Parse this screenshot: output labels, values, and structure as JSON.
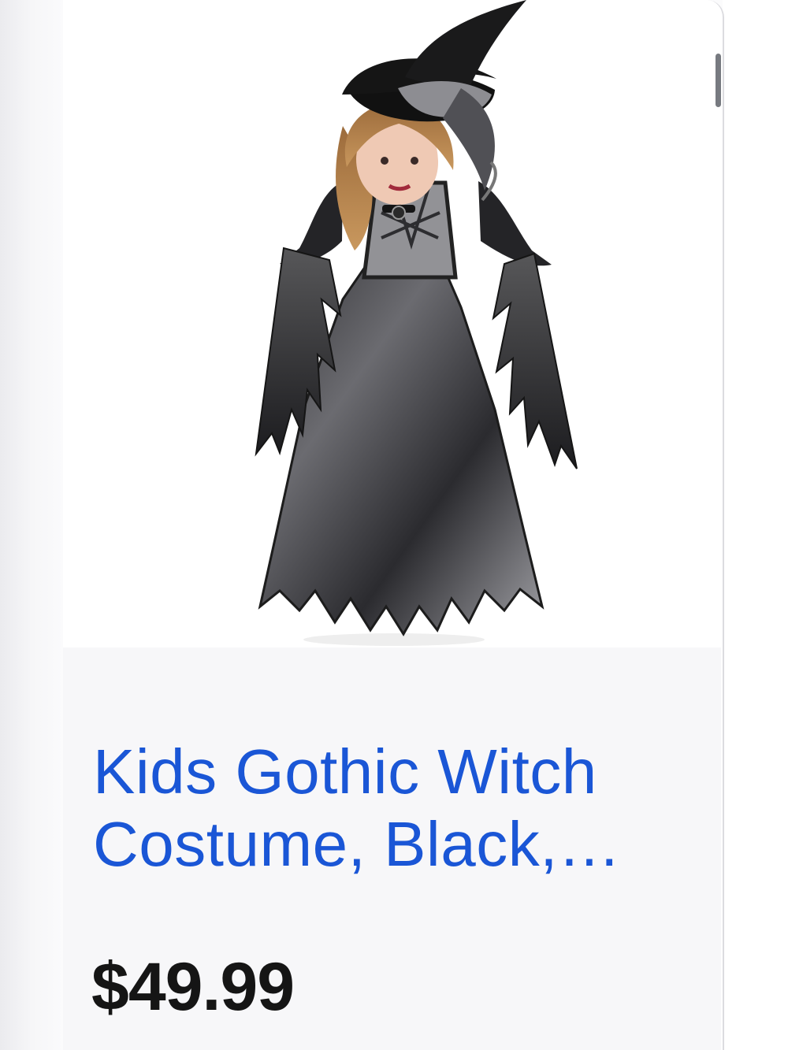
{
  "product": {
    "title_line_1": "Kids Gothic Witch",
    "title_line_2": "Costume, Black,…",
    "price": "$49.99",
    "image_subject": "witch-costume-product-photo"
  },
  "colors": {
    "title_link": "#1a56d6",
    "price": "#151515",
    "panel_background": "#f7f7f9",
    "scrollbar": "#777a80"
  }
}
